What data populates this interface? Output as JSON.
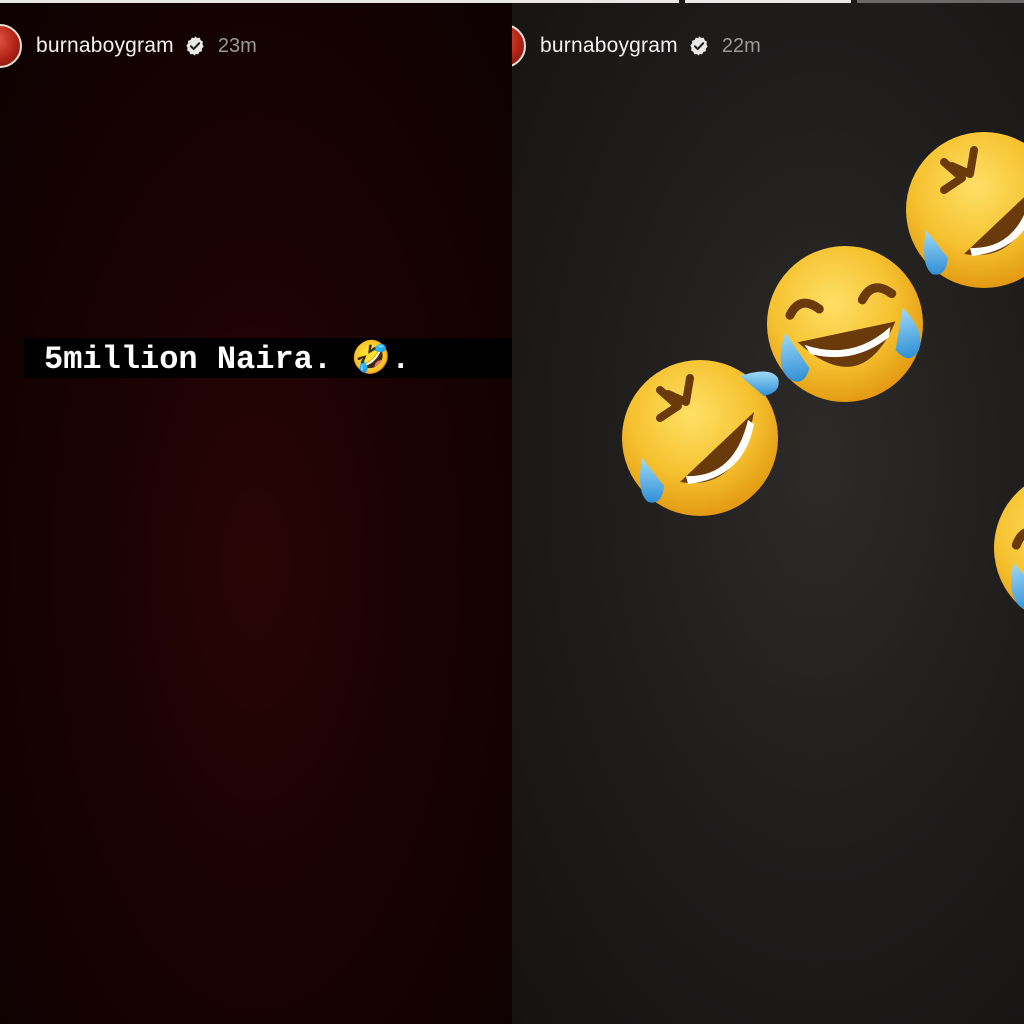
{
  "left_story": {
    "username": "burnaboygram",
    "time": "23m",
    "caption": "5million Naira. 🤣."
  },
  "right_story": {
    "username": "burnaboygram",
    "time": "22m"
  },
  "icons": {
    "verified": "verified-badge-icon",
    "emoji_joy": "face-with-tears-of-joy",
    "emoji_rofl": "rolling-on-floor-laughing"
  },
  "colors": {
    "left_bg": "#1a0203",
    "right_bg": "#1f1d1c",
    "emoji_yellow": "#f6c230",
    "tear_blue": "#5bb8e8"
  }
}
